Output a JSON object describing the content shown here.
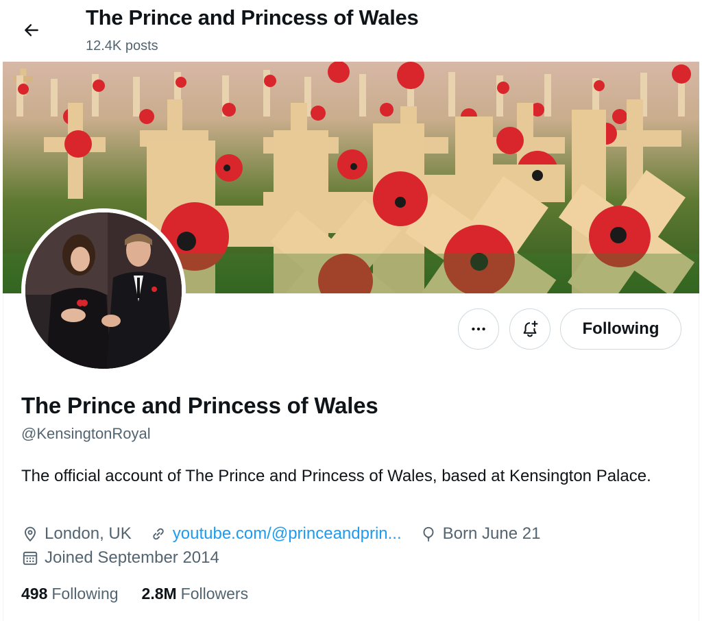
{
  "header": {
    "title": "The Prince and Princess of Wales",
    "posts_count": "12.4K posts"
  },
  "profile": {
    "display_name": "The Prince and Princess of Wales",
    "handle": "@KensingtonRoyal",
    "bio": "The official account of The Prince and Princess of Wales, based at Kensington Palace.",
    "location": "London, UK",
    "website": "youtube.com/@princeandprin...",
    "birthday": "Born June 21",
    "joined": "Joined September 2014"
  },
  "actions": {
    "more_icon": "more-icon",
    "notify_icon": "bell-plus-icon",
    "following_label": "Following"
  },
  "stats": {
    "following_count": "498",
    "following_label": "Following",
    "followers_count": "2.8M",
    "followers_label": "Followers"
  },
  "colors": {
    "accent": "#1d9bf0",
    "secondary_text": "#536471",
    "primary_text": "#0f1419"
  }
}
